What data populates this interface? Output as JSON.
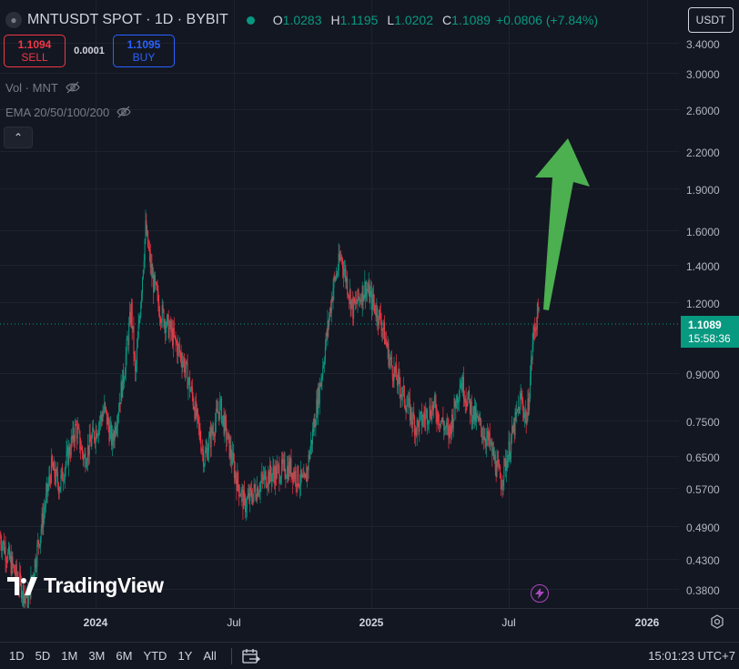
{
  "header": {
    "symbol": "MNTUSDT SPOT · 1D · BYBIT",
    "ohlc": [
      {
        "key": "O",
        "value": "1.0283"
      },
      {
        "key": "H",
        "value": "1.1195"
      },
      {
        "key": "L",
        "value": "1.0202"
      },
      {
        "key": "C",
        "value": "1.1089"
      }
    ],
    "change": "+0.0806 (+7.84%)"
  },
  "trade": {
    "sell_price": "1.1094",
    "sell_label": "SELL",
    "spread": "0.0001",
    "buy_price": "1.1095",
    "buy_label": "BUY"
  },
  "indicators": {
    "volume_label": "Vol · MNT",
    "ema_label": "EMA 20/50/100/200"
  },
  "currency": "USDT",
  "price_scale": [
    "3.4000",
    "3.0000",
    "2.6000",
    "2.2000",
    "1.9000",
    "1.6000",
    "1.4000",
    "1.2000",
    "0.9000",
    "0.7500",
    "0.6500",
    "0.5700",
    "0.4900",
    "0.4300",
    "0.3800"
  ],
  "last_price": {
    "value": "1.1089",
    "countdown": "15:58:36"
  },
  "time_axis": [
    "2024",
    "Jul",
    "2025",
    "Jul",
    "2026"
  ],
  "ranges": [
    "1D",
    "5D",
    "1M",
    "3M",
    "6M",
    "YTD",
    "1Y",
    "All"
  ],
  "clock": "15:01:23 UTC+7",
  "watermark": "TradingView",
  "colors": {
    "background": "#131722",
    "up": "#089981",
    "down": "#f23645",
    "annotation_arrow": "#4caf50",
    "buy": "#2962ff"
  },
  "icons": [
    "eye-off-icon",
    "chevron-up-icon",
    "settings-icon",
    "date-range-icon",
    "flash-icon"
  ],
  "chart_data": {
    "type": "candlestick",
    "symbol": "MNTUSDT",
    "interval": "1D",
    "scale": "log",
    "y_range": [
      0.35,
      3.6
    ],
    "x_range": [
      "2023-10-01",
      "2026-02-05"
    ],
    "close_path": [
      [
        "2023-10-01",
        0.46
      ],
      [
        "2023-10-20",
        0.4
      ],
      [
        "2023-11-05",
        0.36
      ],
      [
        "2023-11-20",
        0.46
      ],
      [
        "2023-12-05",
        0.6
      ],
      [
        "2023-12-15",
        0.56
      ],
      [
        "2024-01-05",
        0.7
      ],
      [
        "2024-01-15",
        0.62
      ],
      [
        "2024-02-10",
        0.75
      ],
      [
        "2024-02-20",
        0.66
      ],
      [
        "2024-03-05",
        0.85
      ],
      [
        "2024-03-15",
        1.1
      ],
      [
        "2024-03-20",
        0.85
      ],
      [
        "2024-04-02",
        1.5
      ],
      [
        "2024-04-10",
        1.25
      ],
      [
        "2024-04-20",
        1.1
      ],
      [
        "2024-05-05",
        1.0
      ],
      [
        "2024-05-20",
        0.9
      ],
      [
        "2024-06-01",
        0.78
      ],
      [
        "2024-06-15",
        0.62
      ],
      [
        "2024-07-05",
        0.76
      ],
      [
        "2024-07-25",
        0.58
      ],
      [
        "2024-08-05",
        0.52
      ],
      [
        "2024-09-01",
        0.58
      ],
      [
        "2024-10-01",
        0.6
      ],
      [
        "2024-10-20",
        0.56
      ],
      [
        "2024-11-10",
        0.85
      ],
      [
        "2024-11-25",
        1.2
      ],
      [
        "2024-12-05",
        1.35
      ],
      [
        "2024-12-20",
        1.1
      ],
      [
        "2025-01-05",
        1.2
      ],
      [
        "2025-01-25",
        1.05
      ],
      [
        "2025-02-05",
        0.9
      ],
      [
        "2025-02-20",
        0.8
      ],
      [
        "2025-03-10",
        0.7
      ],
      [
        "2025-04-01",
        0.76
      ],
      [
        "2025-04-20",
        0.68
      ],
      [
        "2025-05-05",
        0.84
      ],
      [
        "2025-05-20",
        0.74
      ],
      [
        "2025-06-10",
        0.66
      ],
      [
        "2025-06-25",
        0.57
      ],
      [
        "2025-07-05",
        0.64
      ],
      [
        "2025-07-20",
        0.78
      ],
      [
        "2025-07-28",
        0.72
      ],
      [
        "2025-08-05",
        1.0
      ],
      [
        "2025-08-12",
        1.1089
      ]
    ],
    "last_price": 1.1089,
    "annotation": "arrow-up"
  }
}
